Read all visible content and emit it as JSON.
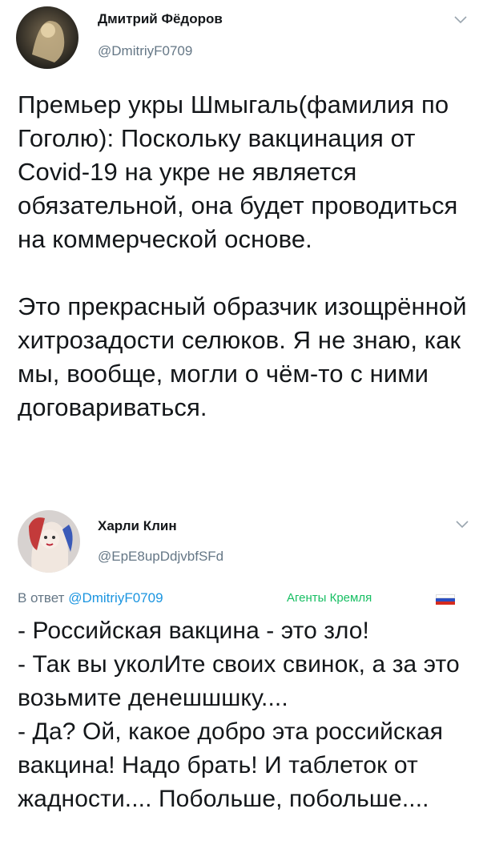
{
  "tweet1": {
    "author_name": "Дмитрий Фёдоров",
    "author_handle": "@DmitriyF0709",
    "paragraphs": [
      "Премьер укры Шмыгаль(фамилия по Гоголю): Поскольку вакцинация от Covid-19 на укре не является обязательной, она будет проводиться на коммерческой основе.",
      "Это прекрасный образчик изощрённой хитрозадости селюков. Я не знаю, как мы, вообще, могли о чём-то с ними договариваться."
    ],
    "menu_icon": "chevron-down-icon"
  },
  "tweet2": {
    "author_name": "Харли Клин",
    "author_handle": "@EpE8upDdjvbfSFd",
    "reply_prefix": "В ответ",
    "reply_mention": "@DmitriyF0709",
    "location_tag": "Агенты Кремля",
    "flag_icon": "russia-flag-icon",
    "menu_icon": "chevron-down-icon",
    "lines": [
      "- Российская вакцина - это зло!",
      "- Так вы уколИте своих свинок, а за это возьмите денешшшку....",
      "- Да? Ой, какое добро эта российская вакцина! Надо брать! И таблеток от жадности.... Побольше, побольше...."
    ]
  },
  "colors": {
    "text": "#14171a",
    "secondary": "#657786",
    "link": "#1b95e0",
    "tag": "#17bf63"
  }
}
